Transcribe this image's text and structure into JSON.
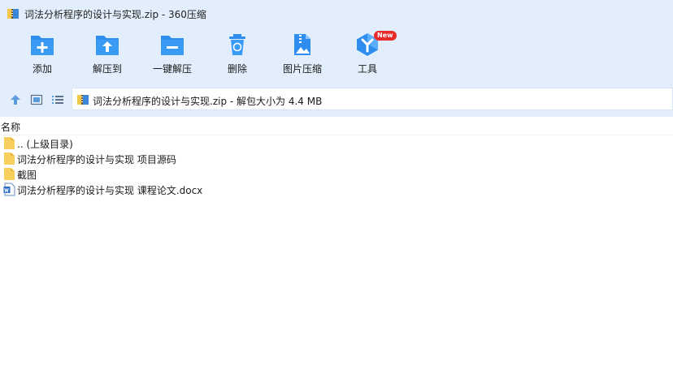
{
  "window": {
    "title": "词法分析程序的设计与实现.zip - 360压缩"
  },
  "toolbar": {
    "buttons": [
      {
        "label": "添加",
        "icon": "add-icon"
      },
      {
        "label": "解压到",
        "icon": "extract-to-icon"
      },
      {
        "label": "一键解压",
        "icon": "one-click-extract-icon"
      },
      {
        "label": "删除",
        "icon": "delete-icon"
      },
      {
        "label": "图片压缩",
        "icon": "image-compress-icon"
      },
      {
        "label": "工具",
        "icon": "tools-icon",
        "badge": "New"
      }
    ]
  },
  "address": {
    "path": "词法分析程序的设计与实现.zip - 解包大小为 4.4 MB"
  },
  "list": {
    "column_name": "名称",
    "items": [
      {
        "name": ".. (上级目录)",
        "type": "parent-folder"
      },
      {
        "name": "词法分析程序的设计与实现 项目源码",
        "type": "folder"
      },
      {
        "name": "截图",
        "type": "folder"
      },
      {
        "name": "词法分析程序的设计与实现 课程论文.docx",
        "type": "word-doc"
      }
    ]
  },
  "colors": {
    "toolbar_bg": "#e2eefb",
    "icon_blue": "#2f8df0",
    "badge_red": "#ea2b2b",
    "folder_yellow": "#f7cf5d"
  }
}
